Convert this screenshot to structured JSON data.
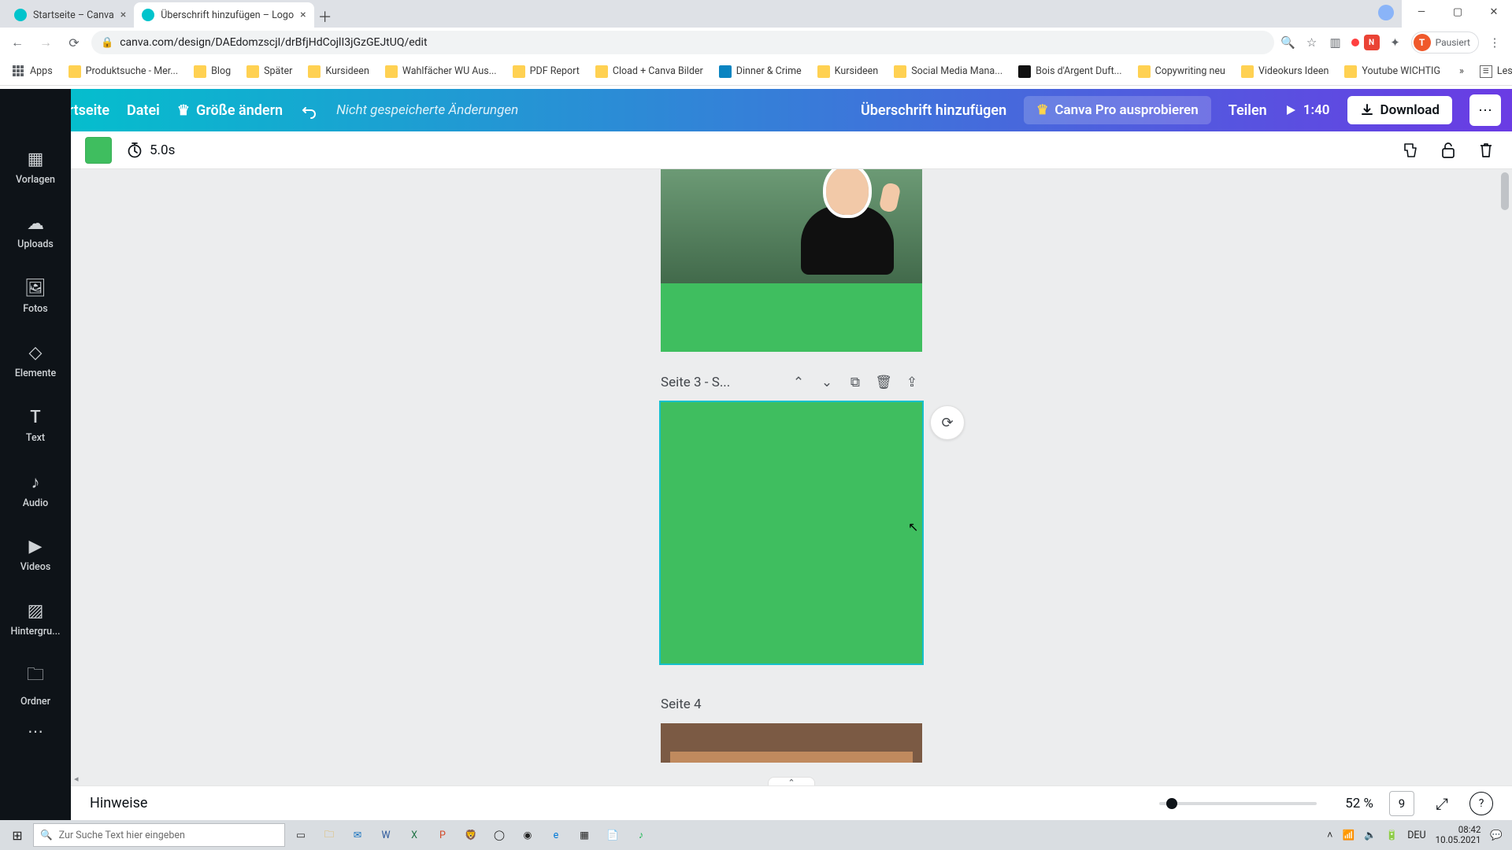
{
  "browser": {
    "tabs": [
      {
        "title": "Startseite – Canva",
        "active": false
      },
      {
        "title": "Überschrift hinzufügen – Logo",
        "active": true
      }
    ],
    "url": "canva.com/design/DAEdomzscjI/drBfjHdCojlI3jGzGEJtUQ/edit",
    "profile_initial": "T",
    "profile_status": "Pausiert",
    "bookmarks": [
      "Apps",
      "Produktsuche - Mer...",
      "Blog",
      "Später",
      "Kursideen",
      "Wahlfächer WU Aus...",
      "PDF Report",
      "Cload + Canva Bilder",
      "Dinner & Crime",
      "Kursideen",
      "Social Media Mana...",
      "Bois d'Argent Duft...",
      "Copywriting neu",
      "Videokurs Ideen",
      "Youtube WICHTIG"
    ],
    "reading_list": "Leseliste"
  },
  "header": {
    "home": "Startseite",
    "file": "Datei",
    "resize": "Größe ändern",
    "unsaved": "Nicht gespeicherte Änderungen",
    "doc_title": "Überschrift hinzufügen",
    "pro": "Canva Pro ausprobieren",
    "share": "Teilen",
    "play_time": "1:40",
    "download": "Download"
  },
  "toolbar": {
    "swatch_color": "#3fbe5f",
    "duration": "5.0s"
  },
  "sidebar": {
    "items": [
      "Vorlagen",
      "Uploads",
      "Fotos",
      "Elemente",
      "Text",
      "Audio",
      "Videos",
      "Hintergru...",
      "Ordner"
    ]
  },
  "pages": {
    "p3_label": "Seite 3 - S...",
    "p4_label": "Seite 4"
  },
  "bottom": {
    "notes": "Hinweise",
    "zoom": "52 %",
    "page_count": "9"
  },
  "taskbar": {
    "search_placeholder": "Zur Suche Text hier eingeben",
    "lang": "DEU",
    "time": "08:42",
    "date": "10.05.2021"
  }
}
